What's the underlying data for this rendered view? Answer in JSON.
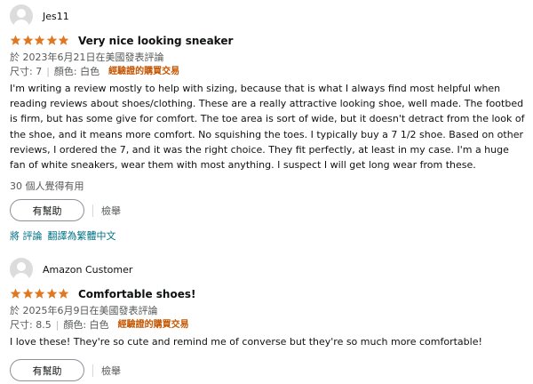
{
  "reviews": [
    {
      "profile_name": "Jes11",
      "rating": 5,
      "title": "Very nice looking sneaker",
      "date": "於 2023年6月21日在美國發表評論",
      "size": "尺寸: 7",
      "color": "顏色: 白色",
      "verified": "經驗證的購買交易",
      "body": "I'm writing a review mostly to help with sizing, because that is what I always find most helpful when reading reviews about shoes/clothing. These are a really attractive looking shoe, well made. The footbed is firm, but has some give for comfort. The toe area is sort of wide, but it doesn't detract from the look of the shoe, and it means more comfort. No squishing the toes. I typically buy a 7 1/2 shoe. Based on other reviews, I ordered the 7, and it was the right choice. They fit perfectly, at least in my case. I'm a huge fan of white sneakers, wear them with most anything. I suspect I will get long wear from these.",
      "helpful_count": "30 個人覺得有用",
      "helpful_button": "有幫助",
      "report": "檢舉",
      "translate_prefix": "將 評論",
      "translate_link": "翻譯為繁體中文"
    },
    {
      "profile_name": "Amazon Customer",
      "rating": 5,
      "title": "Comfortable shoes!",
      "date": "於 2025年6月9日在美國發表評論",
      "size": "尺寸: 8.5",
      "color": "顏色: 白色",
      "verified": "經驗證的購買交易",
      "body": "I love these! They're so cute and remind me of converse but they're so much more comfortable!",
      "helpful_button": "有幫助",
      "report": "檢舉"
    }
  ],
  "colors": {
    "star": "#de7921",
    "link": "#007185",
    "verified": "#c45500",
    "secondary_text": "#565959"
  },
  "icons": [
    "avatar-icon",
    "star-icon"
  ]
}
